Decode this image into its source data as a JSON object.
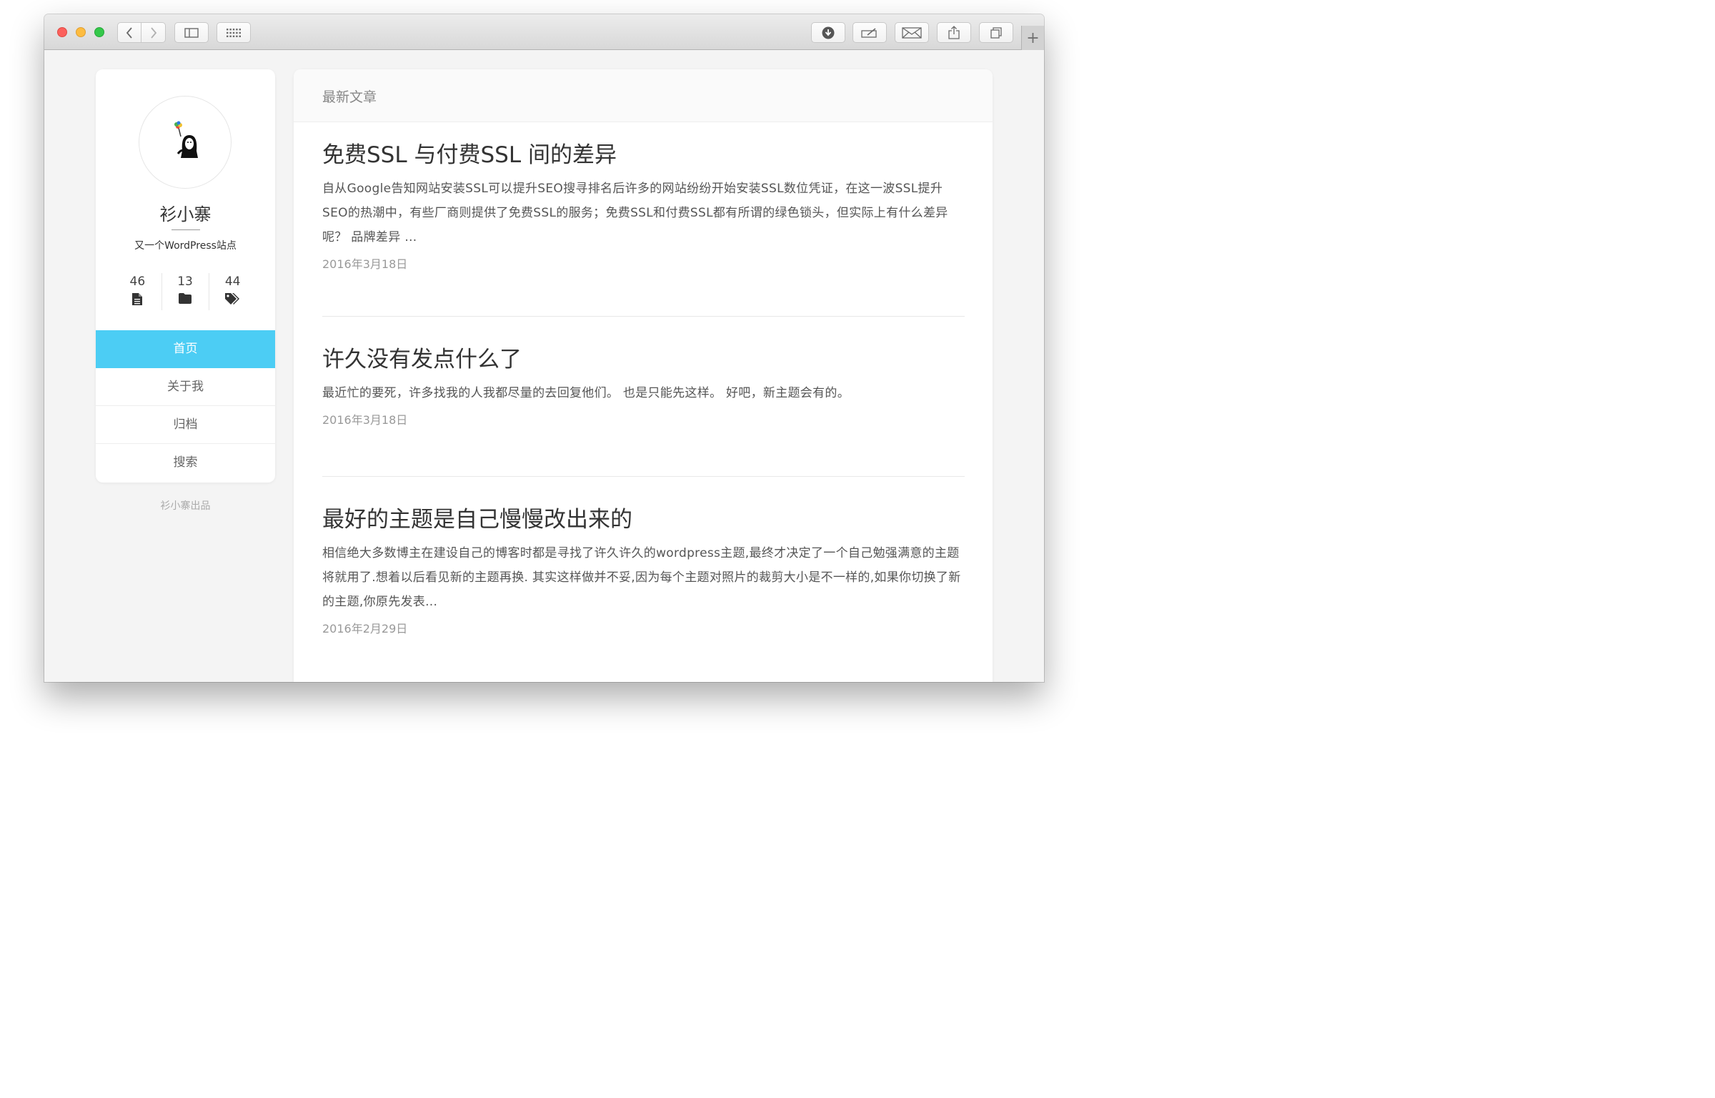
{
  "colors": {
    "accent": "#4ccdf4",
    "titlebar": "#e0e0e0",
    "page_bg": "#f4f4f4"
  },
  "toolbar": {
    "buttons": [
      "back-icon",
      "forward-icon",
      "sidebar-icon",
      "grid-icon",
      "download-icon",
      "edit-icon",
      "bookmark-icon",
      "share-icon",
      "tabs-icon"
    ],
    "new_tab_label": "+"
  },
  "sidebar": {
    "site_name": "衫小寨",
    "site_description": "又一个WordPress站点",
    "stats": [
      {
        "value": "46",
        "icon": "document-icon"
      },
      {
        "value": "13",
        "icon": "folder-icon"
      },
      {
        "value": "44",
        "icon": "tags-icon"
      }
    ],
    "menu": [
      {
        "label": "首页",
        "active": true
      },
      {
        "label": "关于我",
        "active": false
      },
      {
        "label": "归档",
        "active": false
      },
      {
        "label": "搜索",
        "active": false
      }
    ],
    "credit": "衫小寨出品"
  },
  "main": {
    "header": "最新文章",
    "posts": [
      {
        "title": "免费SSL 与付费SSL 间的差异",
        "excerpt": "自从Google告知网站安装SSL可以提升SEO搜寻排名后许多的网站纷纷开始安装SSL数位凭证，在这一波SSL提升SEO的热潮中，有些厂商则提供了免费SSL的服务；免费SSL和付费SSL都有所谓的绿色锁头，但实际上有什么差异呢？ 品牌差异 …",
        "date": "2016年3月18日"
      },
      {
        "title": "许久没有发点什么了",
        "excerpt": "最近忙的要死，许多找我的人我都尽量的去回复他们。 也是只能先这样。 好吧，新主题会有的。",
        "date": "2016年3月18日"
      },
      {
        "title": "最好的主题是自己慢慢改出来的",
        "excerpt": "相信绝大多数博主在建设自己的博客时都是寻找了许久许久的wordpress主题,最终才决定了一个自己勉强满意的主题将就用了.想着以后看见新的主题再换. 其实这样做并不妥,因为每个主题对照片的裁剪大小是不一样的,如果你切换了新的主题,你原先发表...",
        "date": "2016年2月29日"
      }
    ]
  }
}
